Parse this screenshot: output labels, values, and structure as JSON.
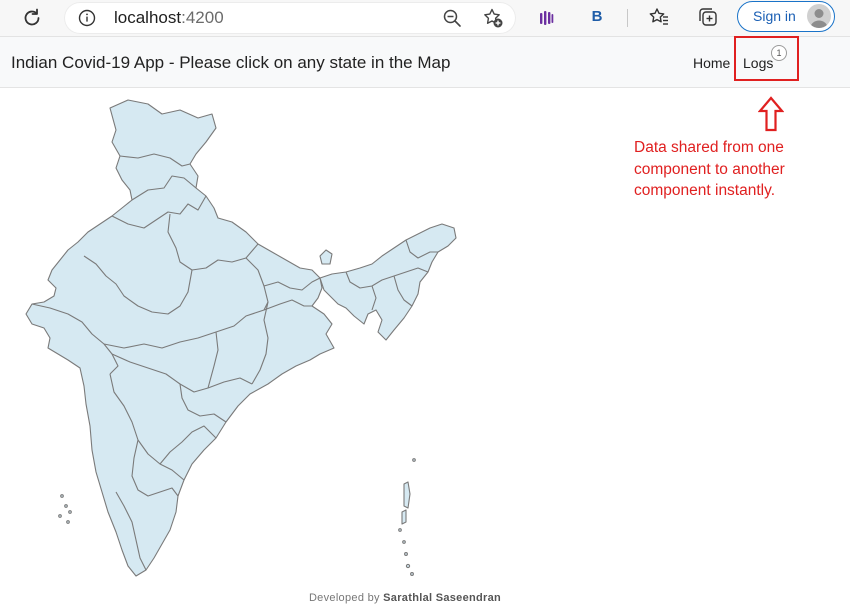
{
  "browser": {
    "url_host": "localhost",
    "url_port": ":4200",
    "extension_b_label": "B",
    "signin_label": "Sign in"
  },
  "navbar": {
    "title": "Indian Covid-19 App - Please click on any state in the Map",
    "home_label": "Home",
    "logs_label": "Logs",
    "logs_badge": "1"
  },
  "annotation": {
    "text": "Data shared from one component to another component instantly.",
    "color": "#e02020"
  },
  "map": {
    "fill": "#d6e9f2",
    "stroke": "#7a7a7a"
  },
  "footer": {
    "prefix": "Developed by",
    "author": "Sarathlal Saseendran"
  }
}
